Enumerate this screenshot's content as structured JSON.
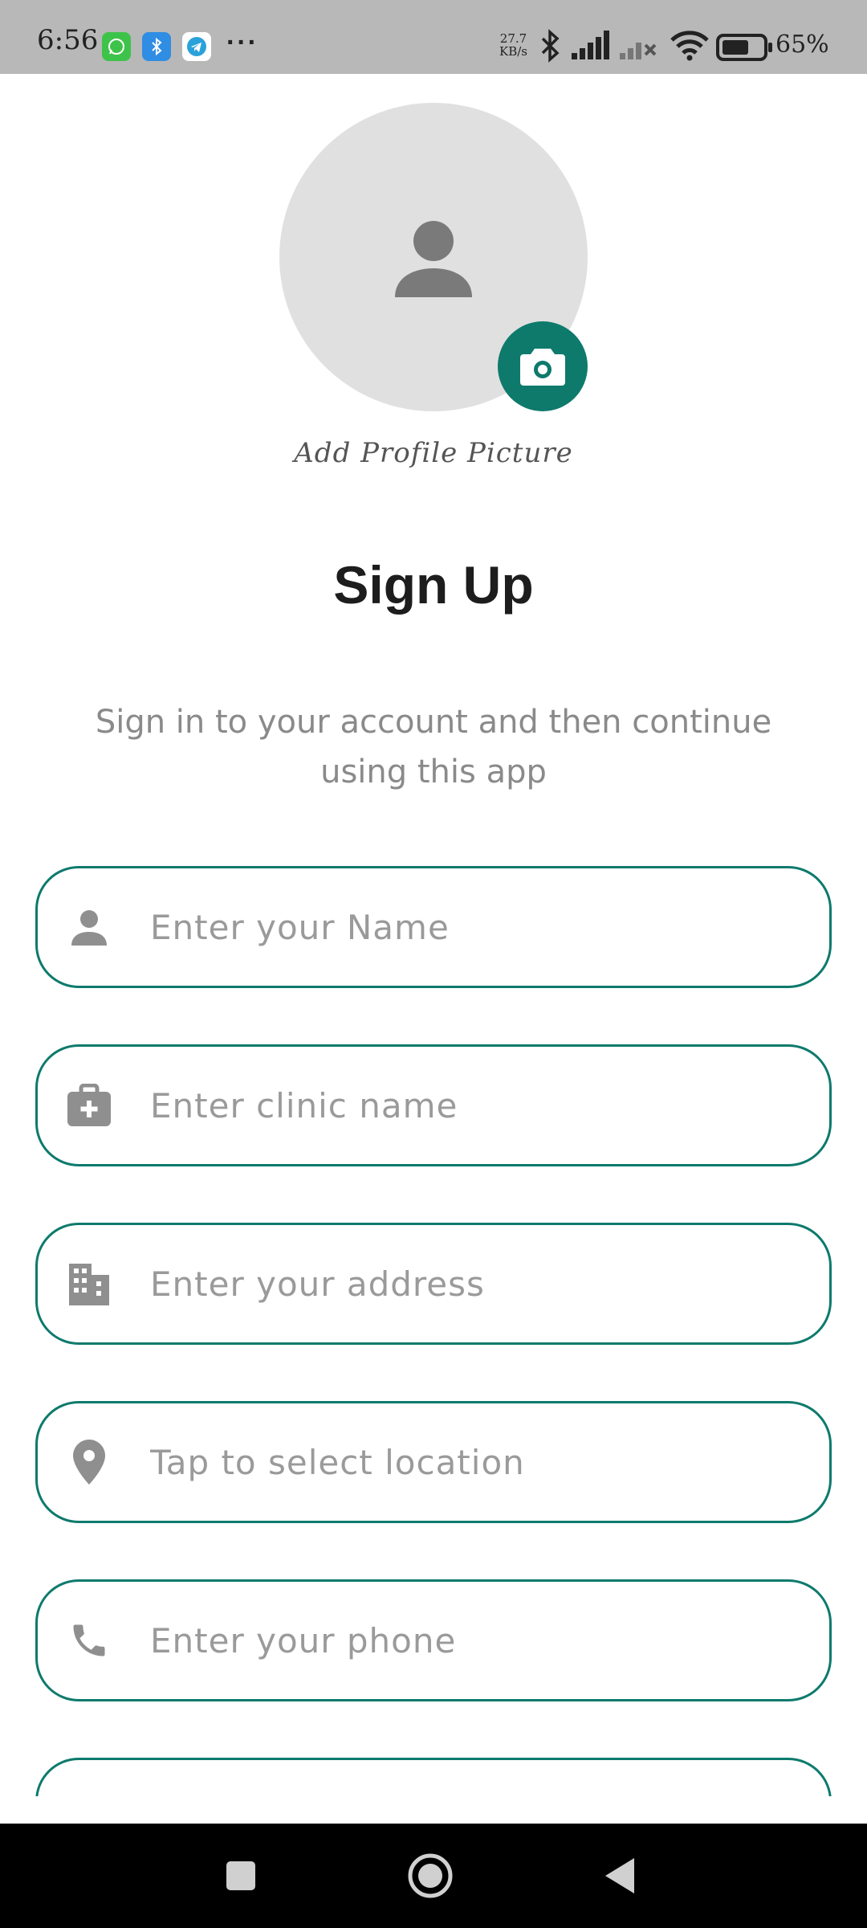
{
  "status_bar": {
    "time": "6:56",
    "net_speed_value": "27.7",
    "net_speed_unit": "KB/s",
    "battery_percent": "65%",
    "more_indicator": "···"
  },
  "profile": {
    "add_picture_label": "Add Profile Picture"
  },
  "header": {
    "title": "Sign Up",
    "subtitle": "Sign in to your account and then continue using this app"
  },
  "form": {
    "name_placeholder": "Enter your Name",
    "clinic_placeholder": "Enter clinic name",
    "address_placeholder": "Enter your address",
    "location_placeholder": "Tap to select location",
    "phone_placeholder": "Enter your phone"
  },
  "colors": {
    "accent": "#0d7a6c",
    "status_bar": "#b8b8b8",
    "avatar_bg": "#e0e0e0"
  }
}
